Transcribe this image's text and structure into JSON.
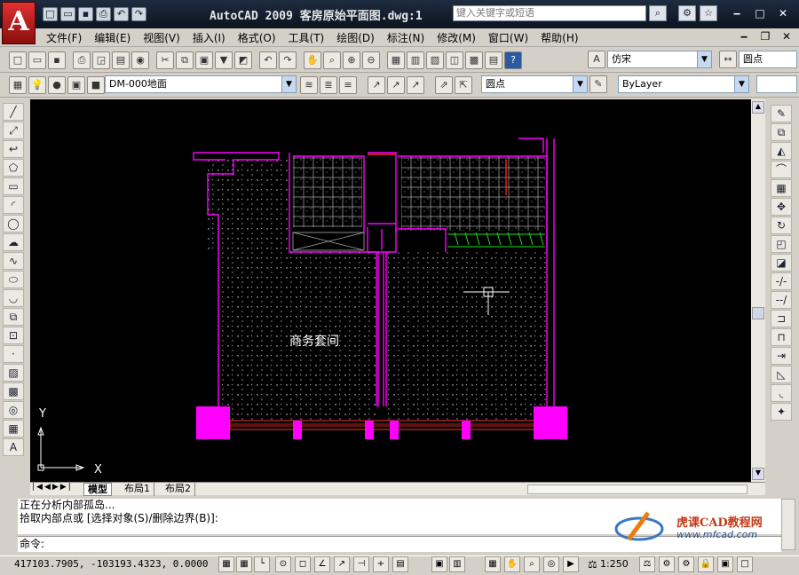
{
  "app": {
    "logo": "A",
    "title": "AutoCAD  2009  客房原始平面图.dwg:1",
    "search_placeholder": "键入关键字或短语",
    "colors": {
      "titlebar": "#1a2638",
      "canvas": "#000000",
      "magenta": "#ff00ff",
      "accent": "#cc1f1f"
    }
  },
  "menu": [
    "文件(F)",
    "编辑(E)",
    "视图(V)",
    "插入(I)",
    "格式(O)",
    "工具(T)",
    "绘图(D)",
    "标注(N)",
    "修改(M)",
    "窗口(W)",
    "帮助(H)"
  ],
  "toolbar": {
    "text_style": "仿宋",
    "dim_style": "圆点",
    "layer": "DM-000地面",
    "multileader_style": "圆点",
    "color": "ByLayer"
  },
  "drawing": {
    "room_label": "商务套间",
    "ucs_y": "Y",
    "ucs_x": "X"
  },
  "tabs": [
    "模型",
    "布局1",
    "布局2"
  ],
  "command": {
    "history": [
      "正在分析内部孤岛...",
      "拾取内部点或 [选择对象(S)/删除边界(B)]:"
    ],
    "prompt": "命令:"
  },
  "status": {
    "coordinates": "417103.7905, -103193.4323, 0.0000",
    "scale": "1:250"
  },
  "watermark": {
    "brand": "虎课CAD教程网",
    "url": "www.mfcad.com"
  }
}
